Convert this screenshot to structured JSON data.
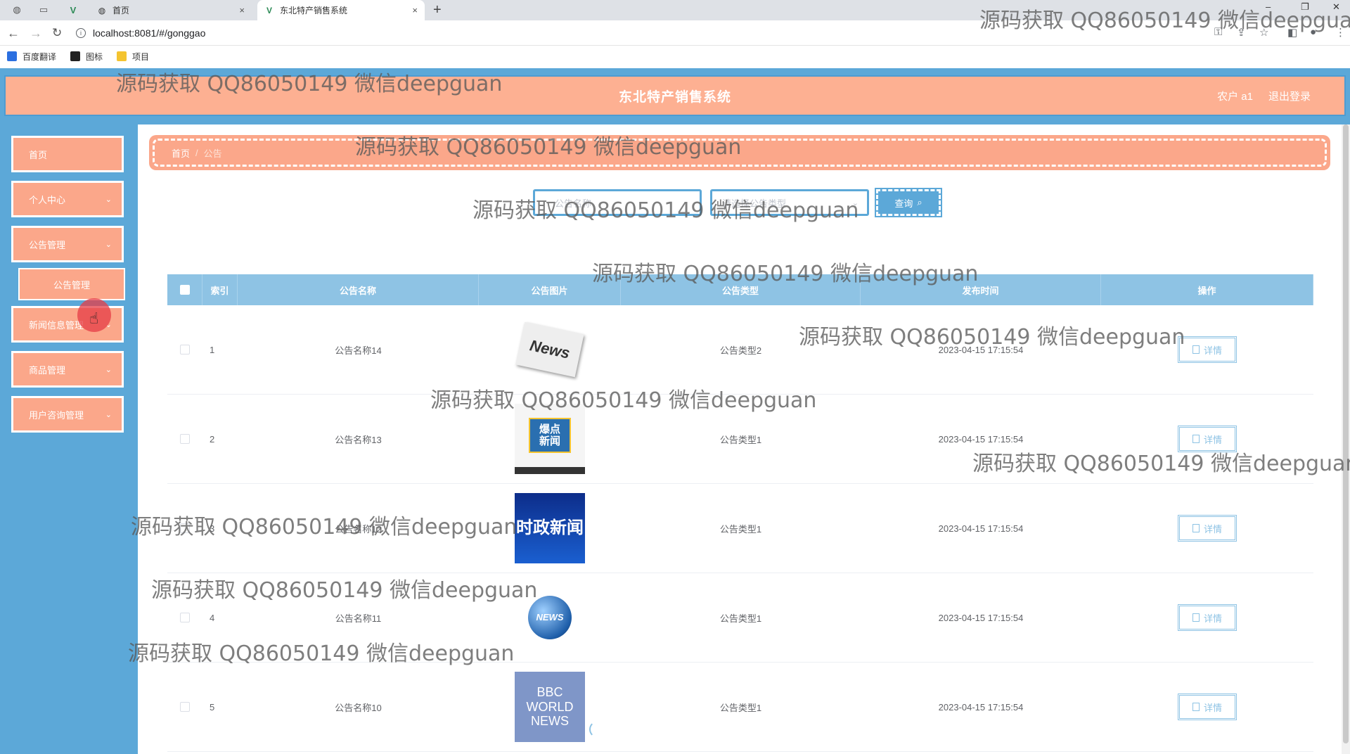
{
  "browser": {
    "tabs": [
      {
        "label": "首页",
        "icon": "globe-icon"
      },
      {
        "label": "东北特产销售系统",
        "icon": "vue-logo-icon"
      }
    ],
    "close_glyph": "×",
    "new_tab_glyph": "+",
    "url": "localhost:8081/#/gonggao",
    "bookmarks": [
      {
        "label": "百度翻译",
        "color": "#2b6fe0"
      },
      {
        "label": "图标",
        "color": "#222222"
      },
      {
        "label": "项目",
        "color": "#f4c430"
      }
    ]
  },
  "app": {
    "title": "东北特产销售系统",
    "user_label": "农户 a1",
    "logout_label": "退出登录",
    "colors": {
      "primary": "#5ca8d8",
      "accent": "#fba78a",
      "header_bg": "#fdb092",
      "table_header": "#8ec3e4"
    }
  },
  "sidebar": {
    "items": [
      {
        "label": "首页",
        "has_arrow": false
      },
      {
        "label": "个人中心",
        "has_arrow": true
      },
      {
        "label": "公告管理",
        "has_arrow": true
      },
      {
        "label": "新闻信息管理",
        "has_arrow": true
      },
      {
        "label": "商品管理",
        "has_arrow": true
      },
      {
        "label": "用户咨询管理",
        "has_arrow": true
      }
    ],
    "sub_item": "公告管理",
    "arrow_glyph": "⌄"
  },
  "breadcrumb": {
    "home": "首页",
    "sep": "/",
    "current": "公告"
  },
  "search": {
    "input_placeholder": "公告名称",
    "select_placeholder": "请选择公告类型",
    "button_label": "查询",
    "button_icon": "search-icon"
  },
  "table": {
    "headers": {
      "index": "索引",
      "name": "公告名称",
      "image": "公告图片",
      "type": "公告类型",
      "time": "发布时间",
      "op": "操作"
    },
    "detail_label": "详情",
    "rows": [
      {
        "index": "1",
        "name": "公告名称14",
        "type": "公告类型2",
        "time": "2023-04-15 17:15:54",
        "image": "news-paper-thumbnail",
        "thumb_text": "News"
      },
      {
        "index": "2",
        "name": "公告名称13",
        "type": "公告类型1",
        "time": "2023-04-15 17:15:54",
        "image": "hot-news-thumbnail",
        "thumb_text": "爆点新闻"
      },
      {
        "index": "3",
        "name": "公告名称12",
        "type": "公告类型1",
        "time": "2023-04-15 17:15:54",
        "image": "political-news-thumbnail",
        "thumb_text": "时政新闻"
      },
      {
        "index": "4",
        "name": "公告名称11",
        "type": "公告类型1",
        "time": "2023-04-15 17:15:54",
        "image": "news-globe-thumbnail",
        "thumb_text": "NEWS"
      },
      {
        "index": "5",
        "name": "公告名称10",
        "type": "公告类型1",
        "time": "2023-04-15 17:15:54",
        "image": "bbc-world-news-thumbnail",
        "thumb_text": "BBC WORLD NEWS"
      }
    ]
  },
  "watermark": "源码获取 QQ86050149 微信deepguan"
}
